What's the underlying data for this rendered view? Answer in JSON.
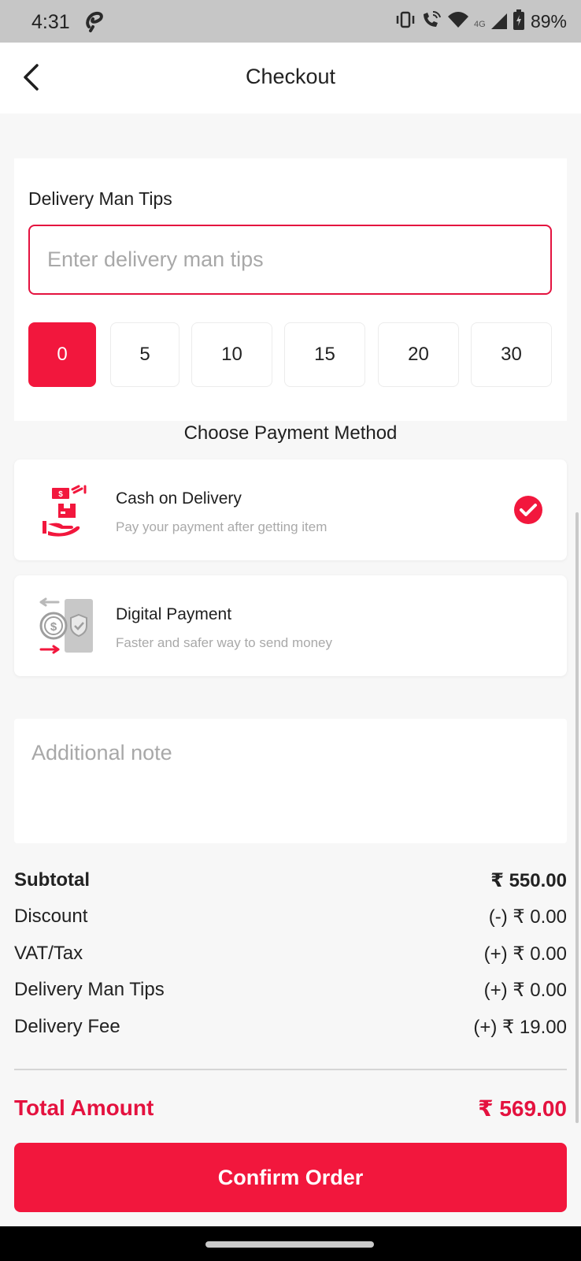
{
  "status_bar": {
    "time": "4:31",
    "battery": "89%",
    "network_label": "4G"
  },
  "header": {
    "title": "Checkout"
  },
  "tips": {
    "title": "Delivery Man Tips",
    "placeholder": "Enter delivery man tips",
    "value": "",
    "options": [
      "0",
      "5",
      "10",
      "15",
      "20",
      "30"
    ],
    "selected": "0"
  },
  "payment": {
    "heading": "Choose Payment Method",
    "methods": [
      {
        "title": "Cash on Delivery",
        "subtitle": "Pay your payment after getting item",
        "icon": "cash-on-delivery-icon",
        "selected": true
      },
      {
        "title": "Digital Payment",
        "subtitle": "Faster and safer way to send money",
        "icon": "digital-payment-icon",
        "selected": false
      }
    ]
  },
  "note": {
    "placeholder": "Additional note",
    "value": ""
  },
  "summary": {
    "rows": [
      {
        "label": "Subtotal",
        "value": "₹ 550.00"
      },
      {
        "label": "Discount",
        "value": "(-) ₹ 0.00"
      },
      {
        "label": "VAT/Tax",
        "value": "(+) ₹ 0.00"
      },
      {
        "label": "Delivery Man Tips",
        "value": "(+) ₹ 0.00"
      },
      {
        "label": "Delivery Fee",
        "value": "(+) ₹ 19.00"
      }
    ],
    "total_label": "Total Amount",
    "total_value": "₹ 569.00"
  },
  "actions": {
    "confirm_label": "Confirm Order"
  },
  "colors": {
    "accent": "#f2173d",
    "accent_text": "#e4123f",
    "muted_text": "#a9a9a9",
    "background": "#f7f7f7"
  }
}
